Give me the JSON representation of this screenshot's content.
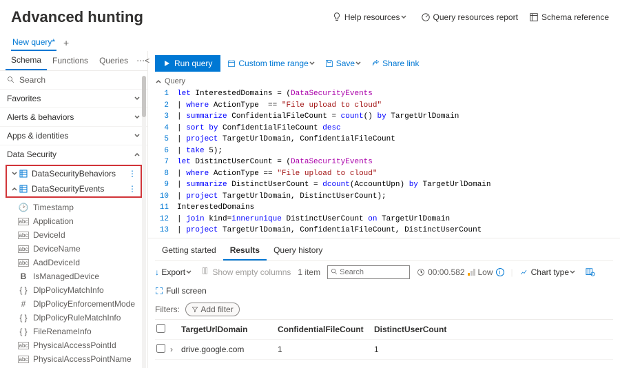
{
  "header": {
    "title": "Advanced hunting",
    "links": {
      "help": "Help resources",
      "report": "Query resources report",
      "schema": "Schema reference"
    }
  },
  "newQuery": "New query*",
  "sideTabs": {
    "schema": "Schema",
    "functions": "Functions",
    "queries": "Queries"
  },
  "search": {
    "placeholder": "Search"
  },
  "categories": {
    "favorites": "Favorites",
    "alerts": "Alerts & behaviors",
    "apps": "Apps & identities",
    "dataSecurity": "Data Security"
  },
  "tree": {
    "behaviors": "DataSecurityBehaviors",
    "events": "DataSecurityEvents",
    "fields": [
      "Timestamp",
      "Application",
      "DeviceId",
      "DeviceName",
      "AadDeviceId",
      "IsManagedDevice",
      "DlpPolicyMatchInfo",
      "DlpPolicyEnforcementMode",
      "DlpPolicyRuleMatchInfo",
      "FileRenameInfo",
      "PhysicalAccessPointId",
      "PhysicalAccessPointName"
    ]
  },
  "fieldIcons": [
    "ts",
    "abc",
    "abc",
    "abc",
    "abc",
    "B",
    "{}",
    "#",
    "{}",
    "{}",
    "abc",
    "abc"
  ],
  "toolbar": {
    "run": "Run query",
    "timerange": "Custom time range",
    "save": "Save",
    "share": "Share link"
  },
  "queryLabel": "Query",
  "code": [
    {
      "no": "1",
      "parts": [
        {
          "c": "kw",
          "t": "let"
        },
        {
          "c": "id",
          "t": " InterestedDomains = ("
        },
        {
          "c": "tbl",
          "t": "DataSecurityEvents"
        }
      ]
    },
    {
      "no": "2",
      "parts": [
        {
          "c": "pipe",
          "t": "| "
        },
        {
          "c": "kw",
          "t": "where"
        },
        {
          "c": "id",
          "t": " ActionType  == "
        },
        {
          "c": "str",
          "t": "\"File upload to cloud\""
        }
      ]
    },
    {
      "no": "3",
      "parts": [
        {
          "c": "pipe",
          "t": "| "
        },
        {
          "c": "kw",
          "t": "summarize"
        },
        {
          "c": "id",
          "t": " ConfidentialFileCount = "
        },
        {
          "c": "fn",
          "t": "count"
        },
        {
          "c": "id",
          "t": "() "
        },
        {
          "c": "by",
          "t": "by"
        },
        {
          "c": "id",
          "t": " TargetUrlDomain"
        }
      ]
    },
    {
      "no": "4",
      "parts": [
        {
          "c": "pipe",
          "t": "| "
        },
        {
          "c": "kw",
          "t": "sort"
        },
        {
          "c": "id",
          "t": " "
        },
        {
          "c": "by",
          "t": "by"
        },
        {
          "c": "id",
          "t": " ConfidentialFileCount "
        },
        {
          "c": "kw",
          "t": "desc"
        }
      ]
    },
    {
      "no": "5",
      "parts": [
        {
          "c": "pipe",
          "t": "| "
        },
        {
          "c": "kw",
          "t": "project"
        },
        {
          "c": "id",
          "t": " TargetUrlDomain, ConfidentialFileCount"
        }
      ]
    },
    {
      "no": "6",
      "parts": [
        {
          "c": "pipe",
          "t": "| "
        },
        {
          "c": "kw",
          "t": "take"
        },
        {
          "c": "id",
          "t": " 5);"
        }
      ]
    },
    {
      "no": "7",
      "parts": [
        {
          "c": "kw",
          "t": "let"
        },
        {
          "c": "id",
          "t": " DistinctUserCount = ("
        },
        {
          "c": "tbl",
          "t": "DataSecurityEvents"
        }
      ]
    },
    {
      "no": "8",
      "parts": [
        {
          "c": "pipe",
          "t": "| "
        },
        {
          "c": "kw",
          "t": "where"
        },
        {
          "c": "id",
          "t": " ActionType == "
        },
        {
          "c": "str",
          "t": "\"File upload to cloud\""
        }
      ]
    },
    {
      "no": "9",
      "parts": [
        {
          "c": "pipe",
          "t": "| "
        },
        {
          "c": "kw",
          "t": "summarize"
        },
        {
          "c": "id",
          "t": " DistinctUserCount = "
        },
        {
          "c": "fn",
          "t": "dcount"
        },
        {
          "c": "id",
          "t": "(AccountUpn) "
        },
        {
          "c": "by",
          "t": "by"
        },
        {
          "c": "id",
          "t": " TargetUrlDomain"
        }
      ]
    },
    {
      "no": "10",
      "parts": [
        {
          "c": "pipe",
          "t": "| "
        },
        {
          "c": "kw",
          "t": "project"
        },
        {
          "c": "id",
          "t": " TargetUrlDomain, DistinctUserCount);"
        }
      ]
    },
    {
      "no": "11",
      "parts": [
        {
          "c": "id",
          "t": "InterestedDomains"
        }
      ]
    },
    {
      "no": "12",
      "parts": [
        {
          "c": "pipe",
          "t": "| "
        },
        {
          "c": "kw",
          "t": "join"
        },
        {
          "c": "id",
          "t": " kind="
        },
        {
          "c": "kw",
          "t": "innerunique"
        },
        {
          "c": "id",
          "t": " DistinctUserCount "
        },
        {
          "c": "by",
          "t": "on"
        },
        {
          "c": "id",
          "t": " TargetUrlDomain"
        }
      ]
    },
    {
      "no": "13",
      "parts": [
        {
          "c": "pipe",
          "t": "| "
        },
        {
          "c": "kw",
          "t": "project"
        },
        {
          "c": "id",
          "t": " TargetUrlDomain, ConfidentialFileCount, DistinctUserCount"
        }
      ]
    }
  ],
  "results": {
    "tabs": {
      "getting": "Getting started",
      "results": "Results",
      "history": "Query history"
    },
    "export": "Export",
    "showEmpty": "Show empty columns",
    "itemCount": "1 item",
    "searchPlaceholder": "Search",
    "time": "00:00.582",
    "low": "Low",
    "chart": "Chart type",
    "fullScreen": "Full screen",
    "filters": "Filters:",
    "addFilter": "Add filter",
    "cols": [
      "TargetUrlDomain",
      "ConfidentialFileCount",
      "DistinctUserCount"
    ],
    "row": {
      "domain": "drive.google.com",
      "conf": "1",
      "dist": "1"
    }
  }
}
